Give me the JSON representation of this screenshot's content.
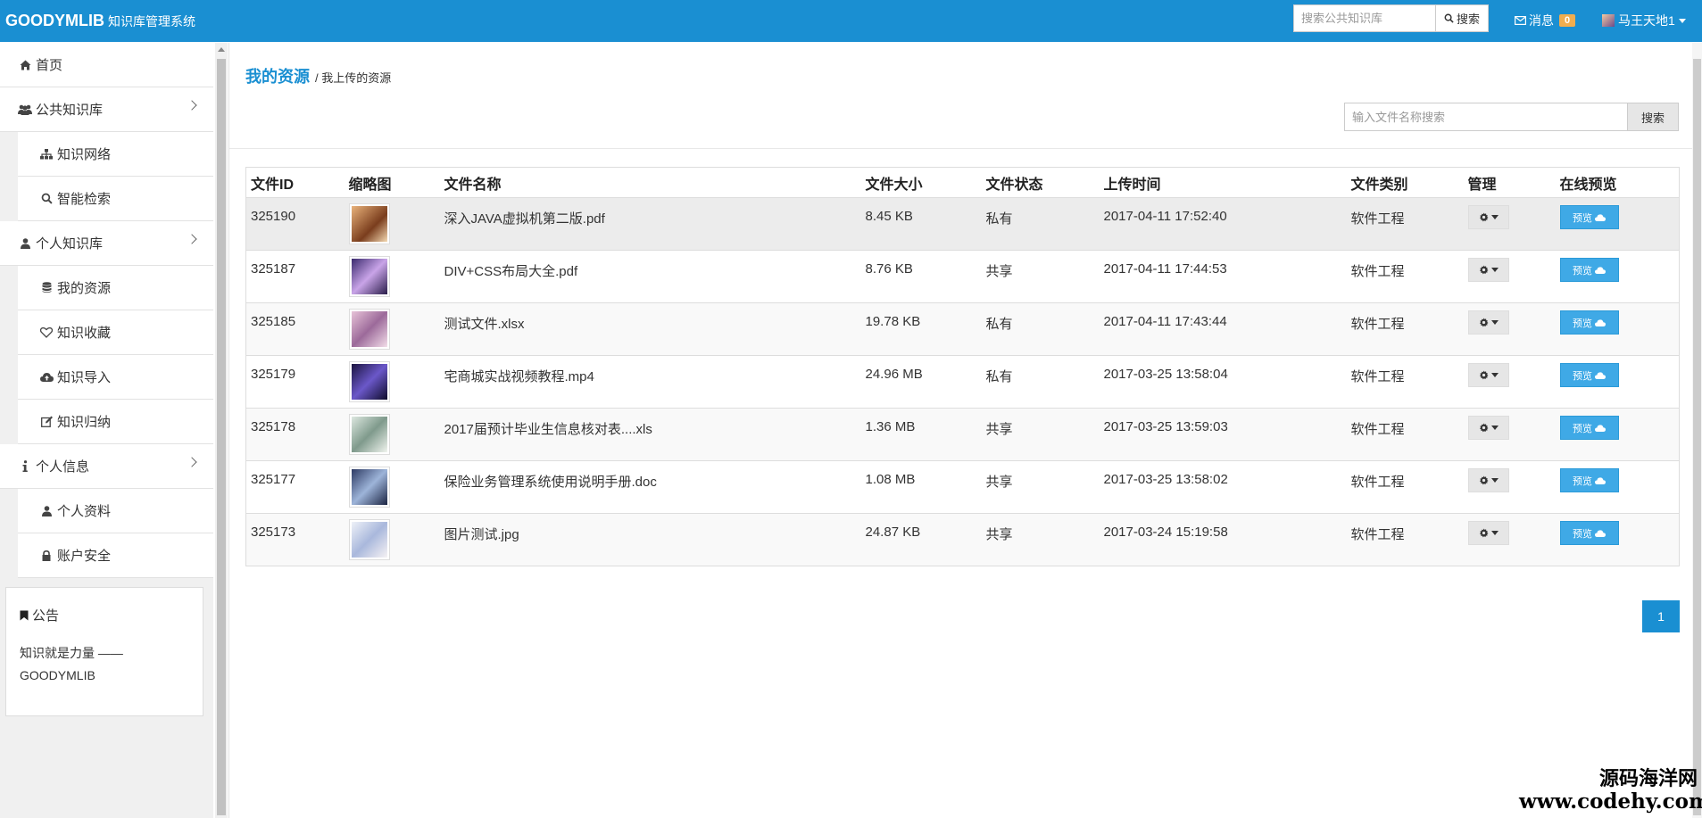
{
  "header": {
    "brand": "GOODYMLIB",
    "brand_sub": "知识库管理系统",
    "search_placeholder": "搜索公共知识库",
    "search_label": "搜索",
    "messages_label": "消息",
    "messages_count": "0",
    "user_name": "马王天地1"
  },
  "sidebar": {
    "items": [
      {
        "label": "首页",
        "icon": "home-icon"
      },
      {
        "label": "公共知识库",
        "icon": "users-icon"
      },
      {
        "label": "知识网络",
        "icon": "sitemap-icon"
      },
      {
        "label": "智能检索",
        "icon": "search-icon"
      },
      {
        "label": "个人知识库",
        "icon": "user-icon"
      },
      {
        "label": "我的资源",
        "icon": "database-icon"
      },
      {
        "label": "知识收藏",
        "icon": "heart-icon"
      },
      {
        "label": "知识导入",
        "icon": "cloud-upload-icon"
      },
      {
        "label": "知识归纳",
        "icon": "edit-icon"
      },
      {
        "label": "个人信息",
        "icon": "info-icon"
      },
      {
        "label": "个人资料",
        "icon": "user-icon"
      },
      {
        "label": "账户安全",
        "icon": "lock-icon"
      }
    ],
    "notice_title": "公告",
    "notice_text": "知识就是力量 —— GOODYMLIB"
  },
  "main": {
    "title": "我的资源",
    "breadcrumb": "/ 我上传的资源",
    "search_placeholder": "输入文件名称搜索",
    "search_label": "搜索",
    "columns": [
      "文件ID",
      "缩略图",
      "文件名称",
      "文件大小",
      "文件状态",
      "上传时间",
      "文件类别",
      "管理",
      "在线预览"
    ],
    "preview_label": "预览",
    "rows": [
      {
        "id": "325190",
        "name": "深入JAVA虚拟机第二版.pdf",
        "size": "8.45 KB",
        "status": "私有",
        "time": "2017-04-11 17:52:40",
        "category": "软件工程"
      },
      {
        "id": "325187",
        "name": "DIV+CSS布局大全.pdf",
        "size": "8.76 KB",
        "status": "共享",
        "time": "2017-04-11 17:44:53",
        "category": "软件工程"
      },
      {
        "id": "325185",
        "name": "测试文件.xlsx",
        "size": "19.78 KB",
        "status": "私有",
        "time": "2017-04-11 17:43:44",
        "category": "软件工程"
      },
      {
        "id": "325179",
        "name": "宅商城实战视频教程.mp4",
        "size": "24.96 MB",
        "status": "私有",
        "time": "2017-03-25 13:58:04",
        "category": "软件工程"
      },
      {
        "id": "325178",
        "name": "2017届预计毕业生信息核对表....xls",
        "size": "1.36 MB",
        "status": "共享",
        "time": "2017-03-25 13:59:03",
        "category": "软件工程"
      },
      {
        "id": "325177",
        "name": "保险业务管理系统使用说明手册.doc",
        "size": "1.08 MB",
        "status": "共享",
        "time": "2017-03-25 13:58:02",
        "category": "软件工程"
      },
      {
        "id": "325173",
        "name": "图片测试.jpg",
        "size": "24.87 KB",
        "status": "共享",
        "time": "2017-03-24 15:19:58",
        "category": "软件工程"
      }
    ],
    "pagination": [
      "1"
    ]
  },
  "watermark": {
    "line1": "源码海洋网",
    "line2": "www.codehy.com"
  },
  "colors": {
    "primary": "#1a8fd2",
    "badge": "#f0ad4e",
    "preview_button": "#3fa9e6"
  }
}
